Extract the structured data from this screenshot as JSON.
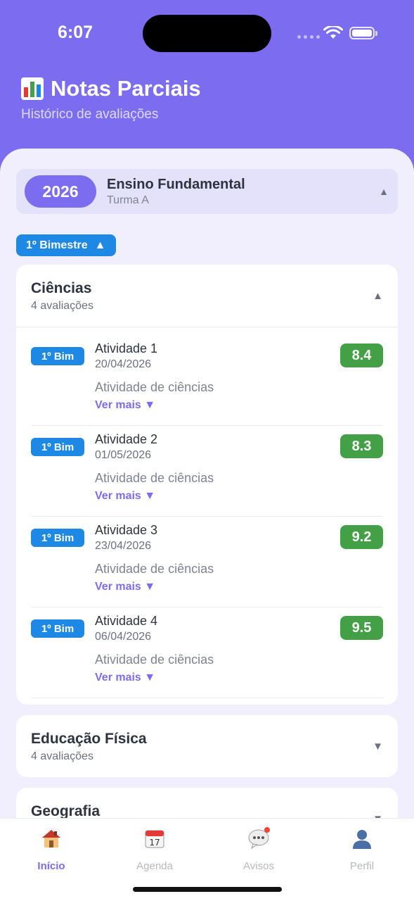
{
  "status_bar": {
    "time": "6:07"
  },
  "header": {
    "icon": "bar-chart-icon",
    "title": "Notas Parciais",
    "subtitle": "Histórico de avaliações"
  },
  "year_selector": {
    "year": "2026",
    "school_level": "Ensino Fundamental",
    "class": "Turma A",
    "caret": "▲"
  },
  "bimester_filter": {
    "label": "1º Bimestre",
    "caret": "▲"
  },
  "subjects": [
    {
      "name": "Ciências",
      "count": "4 avaliações",
      "caret": "▲",
      "expanded": true,
      "items": [
        {
          "badge": "1º Bim",
          "name": "Atividade 1",
          "date": "20/04/2026",
          "description": "Atividade de ciências",
          "more": "Ver mais ▼",
          "grade": "8.4"
        },
        {
          "badge": "1º Bim",
          "name": "Atividade 2",
          "date": "01/05/2026",
          "description": "Atividade de ciências",
          "more": "Ver mais ▼",
          "grade": "8.3"
        },
        {
          "badge": "1º Bim",
          "name": "Atividade 3",
          "date": "23/04/2026",
          "description": "Atividade de ciências",
          "more": "Ver mais ▼",
          "grade": "9.2"
        },
        {
          "badge": "1º Bim",
          "name": "Atividade 4",
          "date": "06/04/2026",
          "description": "Atividade de ciências",
          "more": "Ver mais ▼",
          "grade": "9.5"
        }
      ]
    },
    {
      "name": "Educação Física",
      "count": "4 avaliações",
      "caret": "▼",
      "expanded": false
    },
    {
      "name": "Geografia",
      "caret": "▼",
      "expanded": false
    }
  ],
  "tabbar": [
    {
      "label": "Início",
      "icon": "house-icon",
      "active": true
    },
    {
      "label": "Agenda",
      "icon": "calendar-icon",
      "active": false,
      "icon_text": "17"
    },
    {
      "label": "Avisos",
      "icon": "chat-bubble-icon",
      "active": false
    },
    {
      "label": "Perfil",
      "icon": "user-icon",
      "active": false
    }
  ],
  "colors": {
    "primary": "#7b6cf0",
    "bimester_blue": "#1e88e5",
    "grade_green": "#43a047",
    "sheet_bg": "#f1effd",
    "notification_dot": "#f44336"
  }
}
